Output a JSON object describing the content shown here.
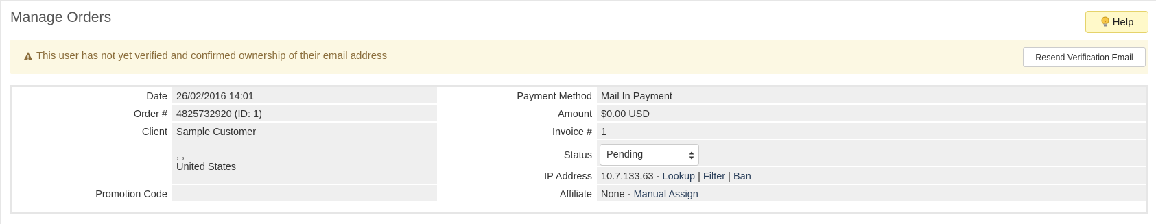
{
  "page": {
    "title": "Manage Orders"
  },
  "help": {
    "label": "Help",
    "icon": "lightbulb-icon"
  },
  "alert": {
    "icon": "warning-icon",
    "message": "This user has not yet verified and confirmed ownership of their email address",
    "resend_label": "Resend Verification Email"
  },
  "order": {
    "left": {
      "date_label": "Date",
      "date_value": "26/02/2016 14:01",
      "order_label": "Order #",
      "order_value": "4825732920 (ID: 1)",
      "client_label": "Client",
      "client_name": "Sample Customer",
      "client_address": ", ,",
      "client_country": "United States",
      "promo_label": "Promotion Code",
      "promo_value": ""
    },
    "right": {
      "payment_label": "Payment Method",
      "payment_value": "Mail In Payment",
      "amount_label": "Amount",
      "amount_value": "$0.00 USD",
      "invoice_label": "Invoice #",
      "invoice_value": "1",
      "status_label": "Status",
      "status_value": "Pending",
      "ip_label": "IP Address",
      "ip_value": "10.7.133.63",
      "ip_dash": " - ",
      "ip_lookup": "Lookup",
      "ip_filter": "Filter",
      "ip_ban": "Ban",
      "ip_sep": " | ",
      "affiliate_label": "Affiliate",
      "affiliate_value": "None",
      "affiliate_dash": " - ",
      "affiliate_assign": "Manual Assign"
    }
  },
  "colors": {
    "alert_bg": "#fcf8e3",
    "alert_text": "#8a6d3b",
    "help_bg": "#fff9c9",
    "value_bg": "#efefef",
    "link": "#2a3f5a"
  }
}
